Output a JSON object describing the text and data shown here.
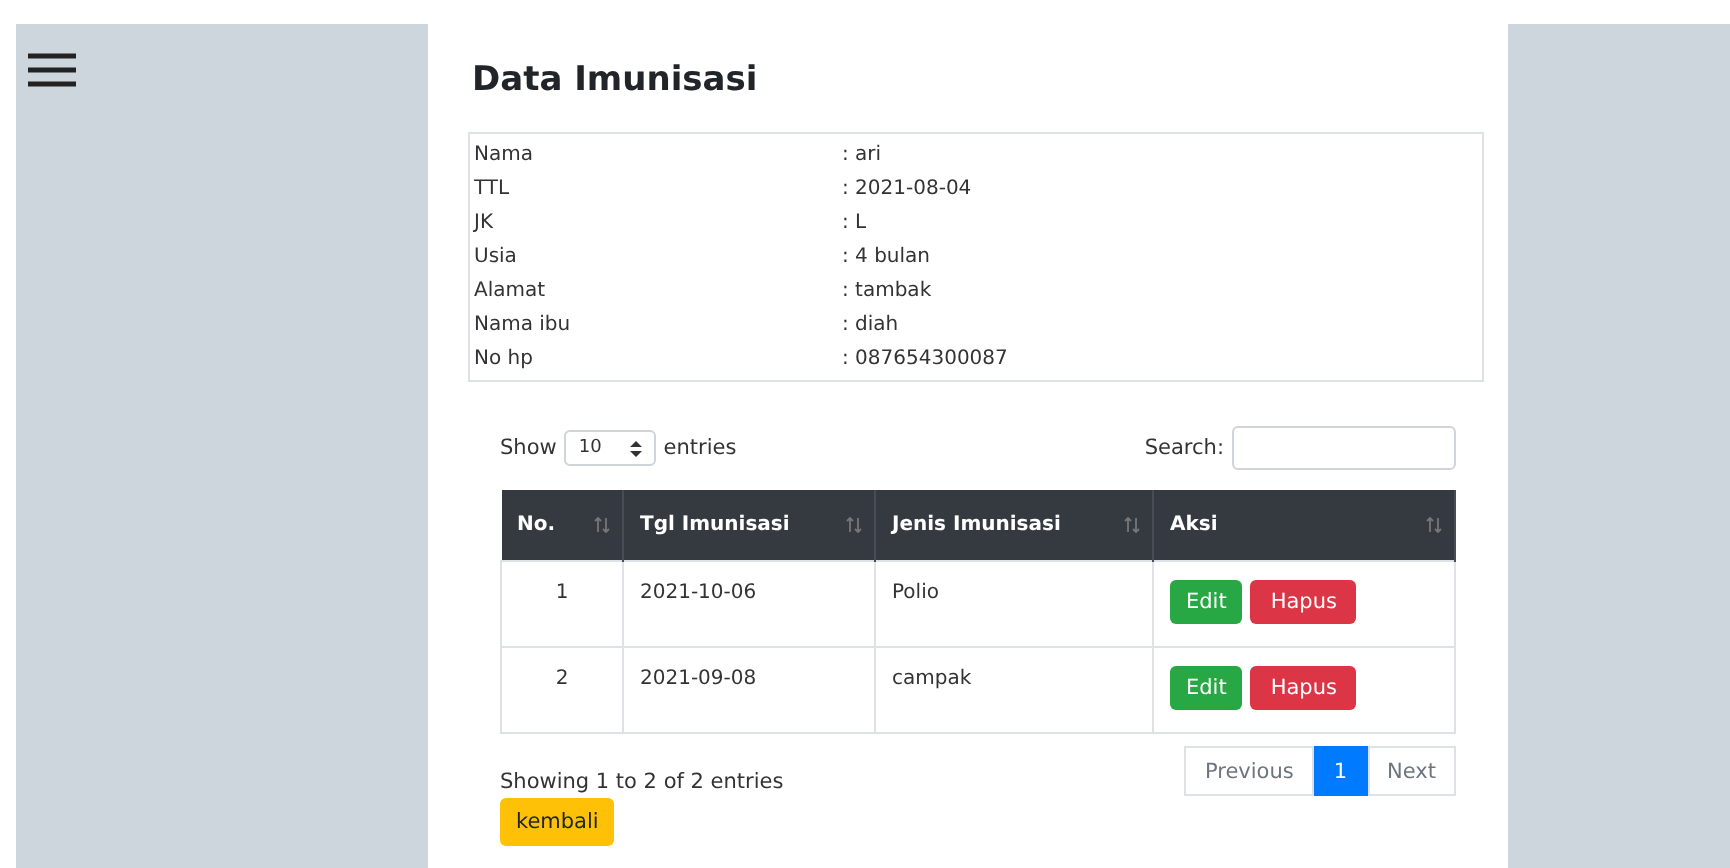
{
  "page": {
    "title": "Data Imunisasi"
  },
  "details": [
    {
      "label": "Nama",
      "value": ": ari"
    },
    {
      "label": "TTL",
      "value": ": 2021-08-04"
    },
    {
      "label": "JK",
      "value": ": L"
    },
    {
      "label": "Usia",
      "value": ": 4 bulan"
    },
    {
      "label": "Alamat",
      "value": ": tambak"
    },
    {
      "label": "Nama ibu",
      "value": ": diah"
    },
    {
      "label": "No hp",
      "value": ": 087654300087"
    }
  ],
  "table_controls": {
    "show_label": "Show",
    "page_size": "10",
    "entries_label": "entries",
    "search_label": "Search:"
  },
  "table": {
    "columns": [
      "No.",
      "Tgl Imunisasi",
      "Jenis Imunisasi",
      "Aksi"
    ],
    "rows": [
      {
        "no": "1",
        "date": "2021-10-06",
        "type": "Polio",
        "actions": [
          "Edit",
          "Hapus"
        ]
      },
      {
        "no": "2",
        "date": "2021-09-08",
        "type": "campak",
        "actions": [
          "Edit",
          "Hapus"
        ]
      }
    ]
  },
  "info": "Showing 1 to 2 of 2 entries",
  "pagination": [
    {
      "label": "Previous",
      "selected": false,
      "disabled": true
    },
    {
      "label": "1",
      "selected": true,
      "disabled": false
    },
    {
      "label": "Next",
      "selected": false,
      "disabled": true
    }
  ],
  "back_button": "kembali"
}
